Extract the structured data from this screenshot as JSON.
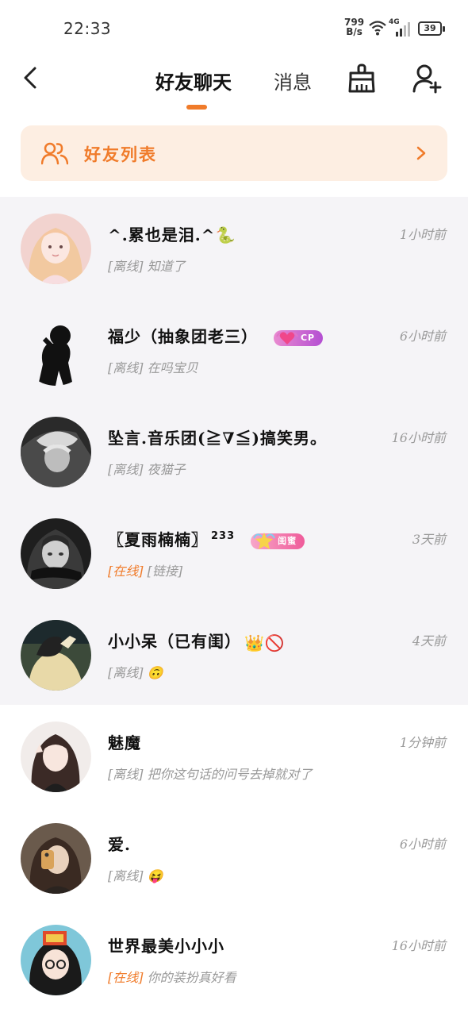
{
  "status_bar": {
    "time": "22:33",
    "speed_value": "799",
    "speed_unit": "B/s",
    "network": "4G",
    "battery": "39"
  },
  "header": {
    "tabs": [
      {
        "label": "好友聊天",
        "active": true
      },
      {
        "label": "消息",
        "active": false
      }
    ],
    "accent_color": "#f07b2a"
  },
  "friend_banner": {
    "label": "好友列表"
  },
  "chats": [
    {
      "name": "^.累也是泪.^🐍",
      "time": "1小时前",
      "status": "[离线]",
      "preview": "知道了",
      "online": false
    },
    {
      "name": "福少（抽象团老三）",
      "time": "6小时前",
      "status": "[离线]",
      "preview": "在吗宝贝",
      "online": false,
      "badge": "CP"
    },
    {
      "name": "坠言.音乐团(≧∇≦)搞笑男。",
      "time": "16小时前",
      "status": "[离线]",
      "preview": "夜猫子",
      "online": false
    },
    {
      "name": "〖夏雨楠楠〗",
      "name_suffix": "233",
      "time": "3天前",
      "status": "[在线]",
      "preview": "[链接]",
      "online": true,
      "badge": "闺蜜"
    },
    {
      "name": "小小呆（已有闺）",
      "name_emoji": "👑🚫",
      "time": "4天前",
      "status": "[离线]",
      "preview": "🙃",
      "online": false
    },
    {
      "name": "魅魔",
      "time": "1分钟前",
      "status": "[离线]",
      "preview": "把你这句话的问号去掉就对了",
      "online": false
    },
    {
      "name": "爱.",
      "time": "6小时前",
      "status": "[离线]",
      "preview": "😝",
      "online": false
    },
    {
      "name": "世界最美小小小",
      "time": "16小时前",
      "status": "[在线]",
      "preview": "你的装扮真好看",
      "online": true
    }
  ]
}
